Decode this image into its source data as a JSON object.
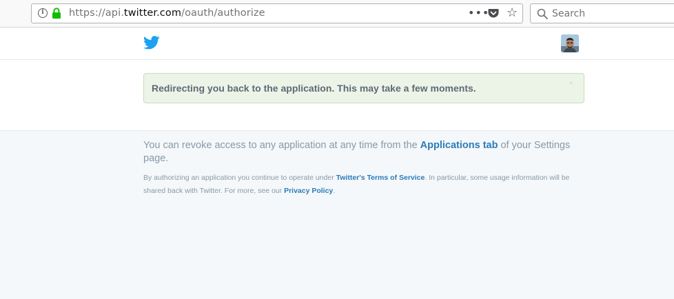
{
  "browser": {
    "url_prefix": "https://api.",
    "url_host": "twitter.com",
    "url_path": "/oauth/authorize",
    "menu_dots": "•••",
    "search_placeholder": "Search"
  },
  "icons": {
    "info": "info-icon",
    "lock": "lock-icon",
    "pocket": "pocket-icon",
    "bookmark": "star-icon",
    "search": "search-icon",
    "brand": "twitter-bird-icon",
    "avatar": "user-avatar"
  },
  "colors": {
    "twitter_blue": "#1da1f2",
    "link_blue": "#2b7bb9",
    "alert_bg": "#ecf4e8",
    "alert_border": "#c6dfb9",
    "lock_green": "#12bc00"
  },
  "alert": {
    "message": "Redirecting you back to the application. This may take a few moments.",
    "close": "×"
  },
  "footer": {
    "revoke_before": "You can revoke access to any application at any time from the ",
    "revoke_link": "Applications tab",
    "revoke_after": " of your Settings page.",
    "legal_before": "By authorizing an application you continue to operate under ",
    "legal_tos_link": "Twitter's Terms of Service",
    "legal_middle": ". In particular, some usage information will be shared back with Twitter. For more, see our ",
    "legal_privacy_link": "Privacy Policy",
    "legal_after": "."
  }
}
